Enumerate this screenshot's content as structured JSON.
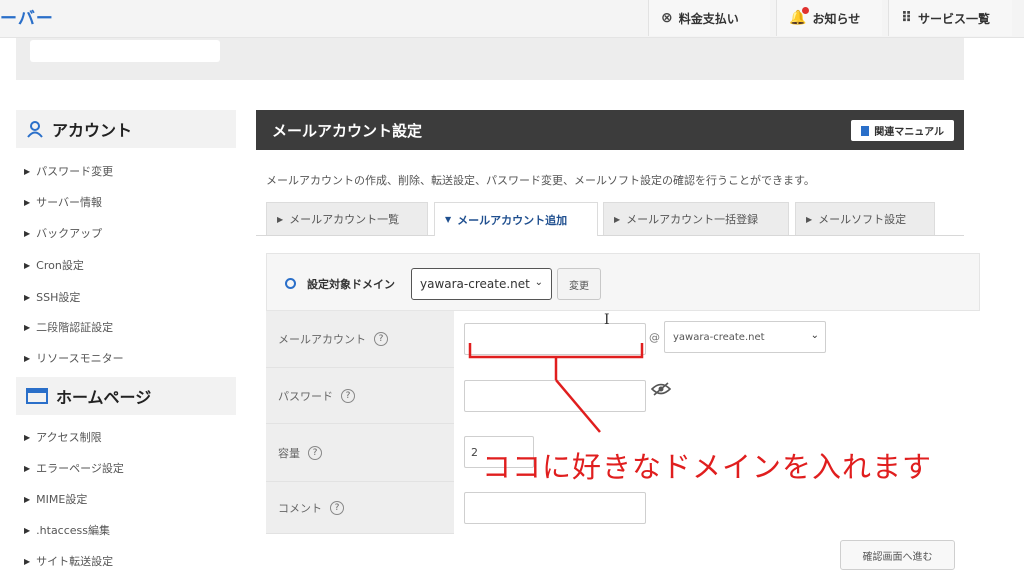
{
  "header": {
    "brand": "ーバー",
    "buttons": [
      {
        "icon": "yen-circle-icon",
        "glyph": "⊗",
        "label": "料金支払い"
      },
      {
        "icon": "bell-icon",
        "glyph": "🔔",
        "label": "お知らせ"
      },
      {
        "icon": "grid-icon",
        "glyph": "⠿",
        "label": "サービス一覧"
      }
    ]
  },
  "sidebar": {
    "sections": [
      {
        "icon": "account-icon",
        "title": "アカウント",
        "items": [
          "パスワード変更",
          "サーバー情報",
          "バックアップ",
          "Cron設定",
          "SSH設定",
          "二段階認証設定",
          "リソースモニター"
        ]
      },
      {
        "icon": "window-icon",
        "title": "ホームページ",
        "items": [
          "アクセス制限",
          "エラーページ設定",
          "MIME設定",
          ".htaccess編集",
          "サイト転送設定"
        ]
      }
    ]
  },
  "main": {
    "title": "メールアカウント設定",
    "manual_label": "関連マニュアル",
    "description": "メールアカウントの作成、削除、転送設定、パスワード変更、メールソフト設定の確認を行うことができます。",
    "tabs": [
      {
        "label": "メールアカウント一覧",
        "active": false
      },
      {
        "label": "メールアカウント追加",
        "active": true
      },
      {
        "label": "メールアカウント一括登録",
        "active": false
      },
      {
        "label": "メールソフト設定",
        "active": false
      }
    ],
    "domain_label": "設定対象ドメイン",
    "domain_value": "yawara-create.net",
    "change_label": "変更",
    "fields": {
      "mail_account": {
        "label": "メールアカウント",
        "value": "",
        "at": "@",
        "domain": "yawara-create.net"
      },
      "password": {
        "label": "パスワード",
        "value": ""
      },
      "capacity": {
        "label": "容量",
        "value": "2"
      },
      "comment": {
        "label": "コメント",
        "value": ""
      }
    },
    "help_glyph": "?",
    "confirm_label": "確認画面へ進む"
  },
  "annotation": {
    "text": "ココに好きなドメインを入れます",
    "color": "#e01e1e"
  }
}
